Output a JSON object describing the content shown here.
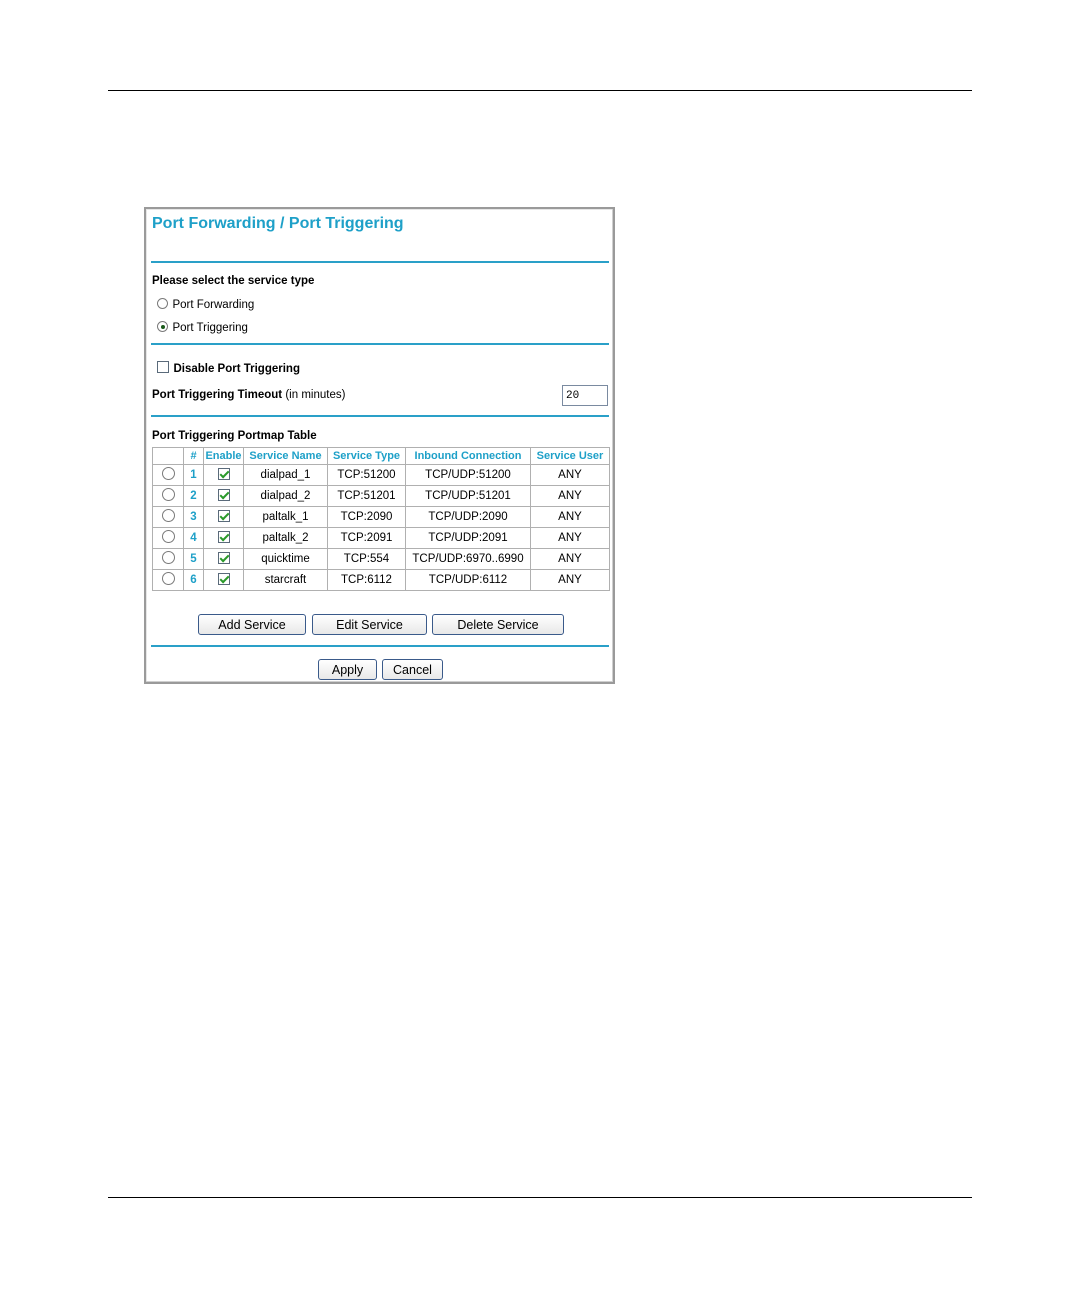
{
  "page": {
    "title": "Port Forwarding / Port Triggering",
    "service_type_heading": "Please select the service type",
    "service_types": [
      {
        "label": "Port Forwarding",
        "selected": false
      },
      {
        "label": "Port Triggering",
        "selected": true
      }
    ],
    "disable_label": "Disable Port Triggering",
    "disable_checked": false,
    "timeout_label": "Port Triggering Timeout",
    "timeout_unit": "(in minutes)",
    "timeout_value": "20",
    "table_title": "Port Triggering Portmap Table",
    "columns": [
      "",
      "#",
      "Enable",
      "Service Name",
      "Service Type",
      "Inbound Connection",
      "Service User"
    ],
    "rows": [
      {
        "num": "1",
        "name": "dialpad_1",
        "type": "TCP:51200",
        "inbound": "TCP/UDP:51200",
        "user": "ANY"
      },
      {
        "num": "2",
        "name": "dialpad_2",
        "type": "TCP:51201",
        "inbound": "TCP/UDP:51201",
        "user": "ANY"
      },
      {
        "num": "3",
        "name": "paltalk_1",
        "type": "TCP:2090",
        "inbound": "TCP/UDP:2090",
        "user": "ANY"
      },
      {
        "num": "4",
        "name": "paltalk_2",
        "type": "TCP:2091",
        "inbound": "TCP/UDP:2091",
        "user": "ANY"
      },
      {
        "num": "5",
        "name": "quicktime",
        "type": "TCP:554",
        "inbound": "TCP/UDP:6970..6990",
        "user": "ANY"
      },
      {
        "num": "6",
        "name": "starcraft",
        "type": "TCP:6112",
        "inbound": "TCP/UDP:6112",
        "user": "ANY"
      }
    ],
    "buttons": {
      "add": "Add Service",
      "edit": "Edit Service",
      "delete": "Delete Service",
      "apply": "Apply",
      "cancel": "Cancel"
    },
    "colors": {
      "accent": "#1ea0c8",
      "check": "#2a9a2a"
    }
  }
}
